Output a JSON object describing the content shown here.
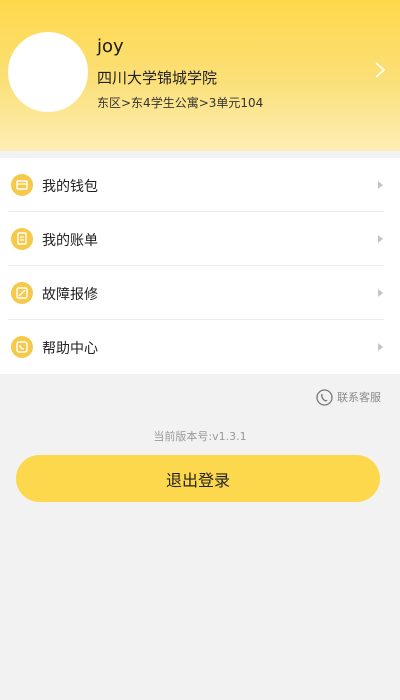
{
  "profile": {
    "username": "joy",
    "school": "四川大学锦城学院",
    "address": "东区>东4学生公寓>3单元104"
  },
  "menu": {
    "items": [
      {
        "label": "我的钱包",
        "icon": "wallet-icon"
      },
      {
        "label": "我的账单",
        "icon": "bill-icon"
      },
      {
        "label": "故障报修",
        "icon": "repair-icon"
      },
      {
        "label": "帮助中心",
        "icon": "help-phone-icon"
      }
    ]
  },
  "contact": {
    "label": "联系客服",
    "icon": "customer-service-icon"
  },
  "version": {
    "text": "当前版本号:v1.3.1"
  },
  "logout": {
    "label": "退出登录"
  },
  "colors": {
    "accent": "#fdd84c",
    "icon_fill": "#f6c94a",
    "background": "#f2f2f2"
  }
}
